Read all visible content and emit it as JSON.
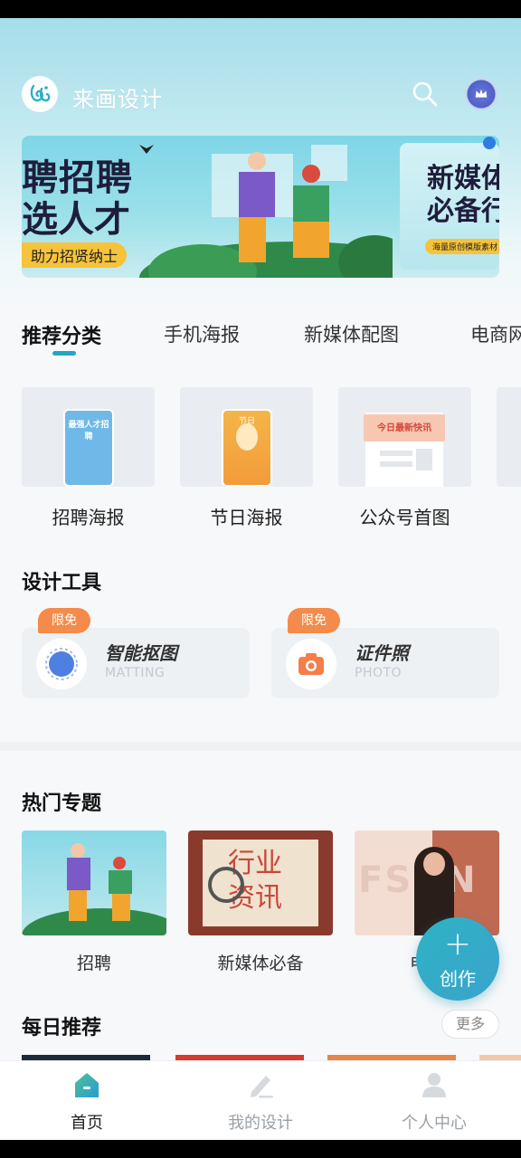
{
  "app": {
    "title": "来画设计"
  },
  "colors": {
    "accent": "#23a6c4",
    "badge": "#f48b4a",
    "banner_pill": "#f6c33b"
  },
  "header": {
    "search_icon": "search-icon",
    "avatar_icon": "crown-avatar-icon"
  },
  "banner": {
    "main_line1": "聘招聘",
    "main_line2": "选人才",
    "main_pill": "助力招贤纳士",
    "next_line1": "新媒体",
    "next_line2": "必备行",
    "next_pill": "海量原创模版素材"
  },
  "tabs": [
    {
      "label": "推荐分类",
      "active": true
    },
    {
      "label": "手机海报"
    },
    {
      "label": "新媒体配图"
    },
    {
      "label": "电商网"
    }
  ],
  "categories": [
    {
      "label": "招聘海报",
      "thumb_text": "最强人才招聘"
    },
    {
      "label": "节日海报",
      "thumb_text": "节日"
    },
    {
      "label": "公众号首图",
      "thumb_text": "今日最新快讯"
    }
  ],
  "tools": {
    "title": "设计工具",
    "items": [
      {
        "badge": "限免",
        "name": "智能抠图",
        "sub": "MATTING"
      },
      {
        "badge": "限免",
        "name": "证件照",
        "sub": "PHOTO"
      }
    ]
  },
  "topics": {
    "title": "热门专题",
    "items": [
      {
        "label": "招聘"
      },
      {
        "label": "新媒体必备",
        "art_line1": "行业",
        "art_line2": "资讯"
      },
      {
        "label": "电商",
        "art_text": "FSON"
      }
    ]
  },
  "fab": {
    "plus": "+",
    "label": "创作"
  },
  "daily": {
    "title": "每日推荐",
    "more": "更多"
  },
  "nav": [
    {
      "label": "首页",
      "active": true
    },
    {
      "label": "我的设计"
    },
    {
      "label": "个人中心"
    }
  ]
}
